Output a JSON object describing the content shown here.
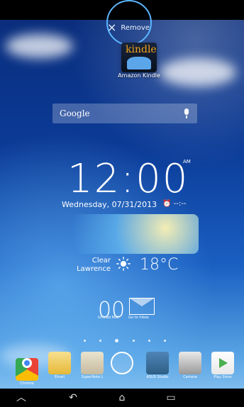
{
  "remove_label": "Remove",
  "widget_kindle": {
    "title": "Amazon Kindle",
    "logo_text": "kindle"
  },
  "search": {
    "label": "Google"
  },
  "clock": {
    "time": "12:00",
    "ampm": "AM",
    "date": "Wednesday, 07/31/2013",
    "alarm": "--:--"
  },
  "weather": {
    "condition": "Clear",
    "location": "Lawrence",
    "temperature": "18°C"
  },
  "email_widget": {
    "count": "00",
    "unread_label": "Unread Mail",
    "go_inbox_label": "Go to Inbox"
  },
  "page_indicator": {
    "total": 6,
    "active": 3
  },
  "dock_apps": [
    {
      "name": "Chrome"
    },
    {
      "name": "Email"
    },
    {
      "name": "SuperNote L"
    },
    {
      "name": ""
    },
    {
      "name": "ASUS Studio"
    },
    {
      "name": "Camera"
    },
    {
      "name": "Play Store"
    }
  ],
  "navigation": {
    "home": "home",
    "back": "back",
    "recents": "recent apps"
  },
  "colors": {
    "accent": "#5ab6ff",
    "weather_glow": "#ffe7a0"
  }
}
